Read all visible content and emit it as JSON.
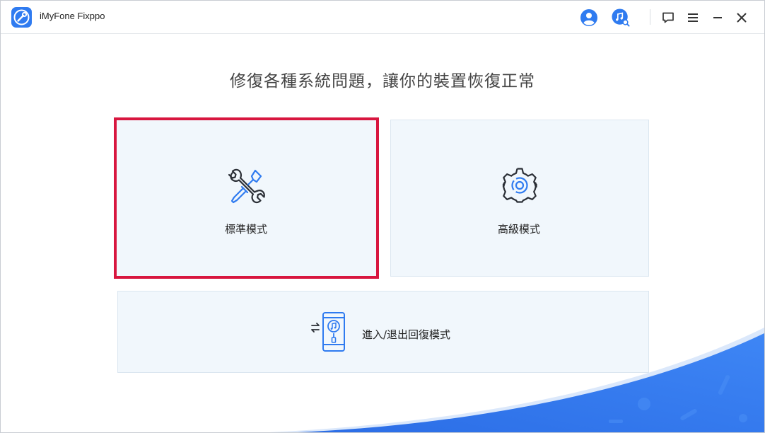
{
  "app": {
    "title": "iMyFone Fixppo"
  },
  "header": {
    "icons": [
      "user-icon",
      "music-search-icon",
      "feedback-icon",
      "menu-icon",
      "minimize-icon",
      "close-icon"
    ]
  },
  "main": {
    "heading": "修復各種系統問題，讓你的裝置恢復正常",
    "modes": [
      {
        "label": "標準模式",
        "icon": "wrench-screwdriver-icon",
        "selected": true
      },
      {
        "label": "高級模式",
        "icon": "gear-icon",
        "selected": false
      }
    ],
    "recovery": {
      "label": "進入/退出回復模式",
      "icon": "phone-recovery-icon"
    }
  },
  "colors": {
    "accent": "#2f7bf0",
    "selected_border": "#d8163f",
    "card_bg": "#f1f7fc",
    "wave": "#2e6fe8"
  }
}
